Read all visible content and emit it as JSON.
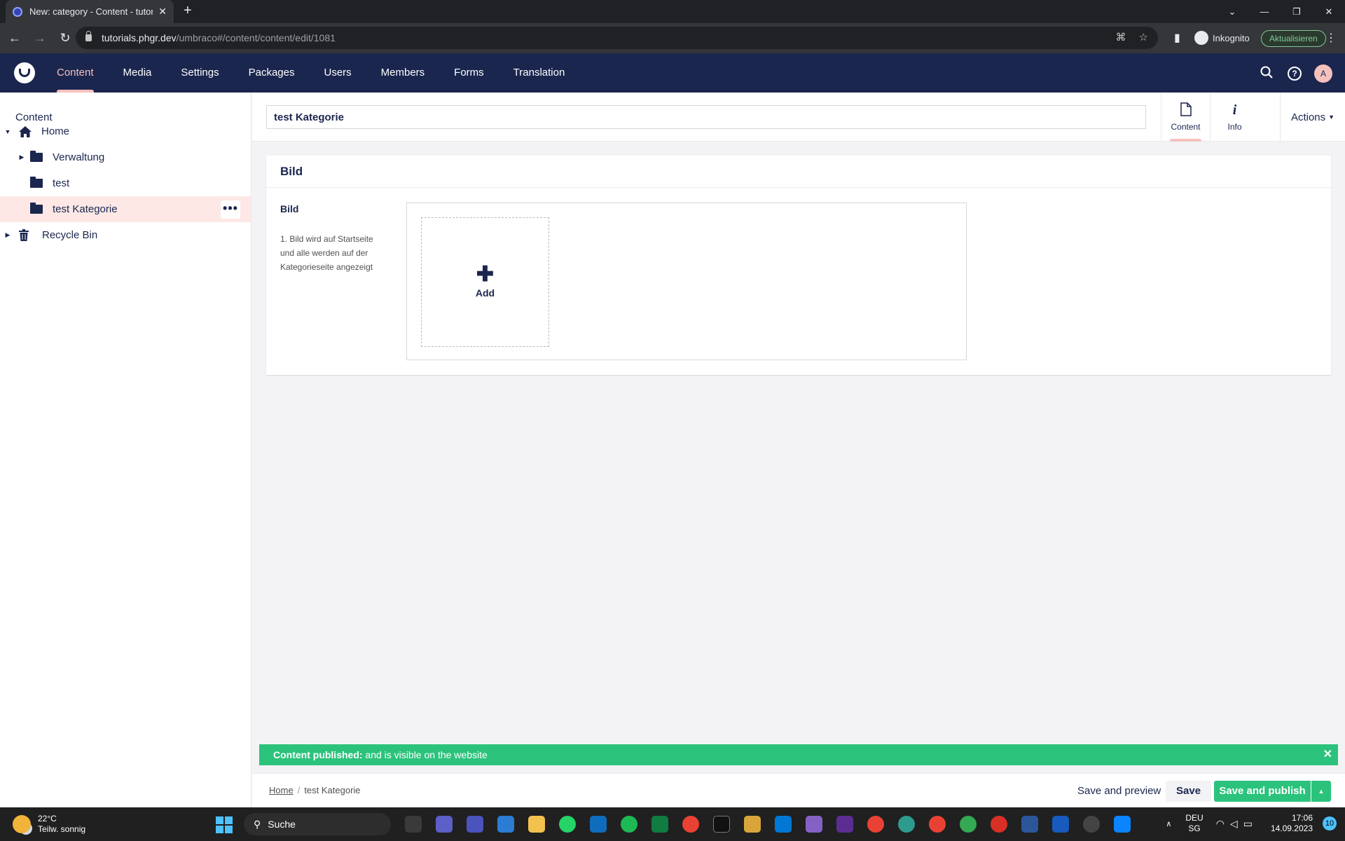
{
  "browser": {
    "tab_title": "New: category - Content - tutorials",
    "url_host": "tutorials.phgr.dev",
    "url_path": "/umbraco#/content/content/edit/1081",
    "incognito_label": "Inkognito",
    "update_label": "Aktualisieren"
  },
  "header": {
    "sections": [
      {
        "label": "Content",
        "active": true
      },
      {
        "label": "Media"
      },
      {
        "label": "Settings"
      },
      {
        "label": "Packages"
      },
      {
        "label": "Users"
      },
      {
        "label": "Members"
      },
      {
        "label": "Forms"
      },
      {
        "label": "Translation"
      }
    ],
    "avatar_initial": "A"
  },
  "tree": {
    "title": "Content",
    "items": [
      {
        "label": "Home",
        "icon": "home-icon"
      },
      {
        "label": "Verwaltung",
        "icon": "folder-icon"
      },
      {
        "label": "test",
        "icon": "folder-icon"
      },
      {
        "label": "test Kategorie",
        "icon": "folder-icon",
        "active": true
      },
      {
        "label": "Recycle Bin",
        "icon": "trash-icon"
      }
    ]
  },
  "editor": {
    "name_value": "test Kategorie",
    "apps": [
      {
        "label": "Content",
        "icon": "document-icon",
        "active": true
      },
      {
        "label": "Info",
        "icon": "info-icon"
      }
    ],
    "actions_label": "Actions"
  },
  "panel": {
    "title": "Bild",
    "property_label": "Bild",
    "property_description": "1. Bild wird auf Startseite und alle werden auf der Kategorieseite angezeigt",
    "add_label": "Add"
  },
  "notification": {
    "title": "Content published:",
    "message": " and is visible on the website"
  },
  "footer": {
    "breadcrumb_home": "Home",
    "breadcrumb_current": "test Kategorie",
    "save_preview_label": "Save and preview",
    "save_label": "Save",
    "publish_label": "Save and publish"
  },
  "taskbar": {
    "temperature": "22°C",
    "weather": "Teilw. sonnig",
    "search_label": "Suche",
    "lang_1": "DEU",
    "lang_2": "SG",
    "time": "17:06",
    "date": "14.09.2023",
    "notification_count": "10"
  },
  "colors": {
    "brand_navy": "#1b264f",
    "accent_pink": "#f5c1bc",
    "success_green": "#2bc37c"
  }
}
